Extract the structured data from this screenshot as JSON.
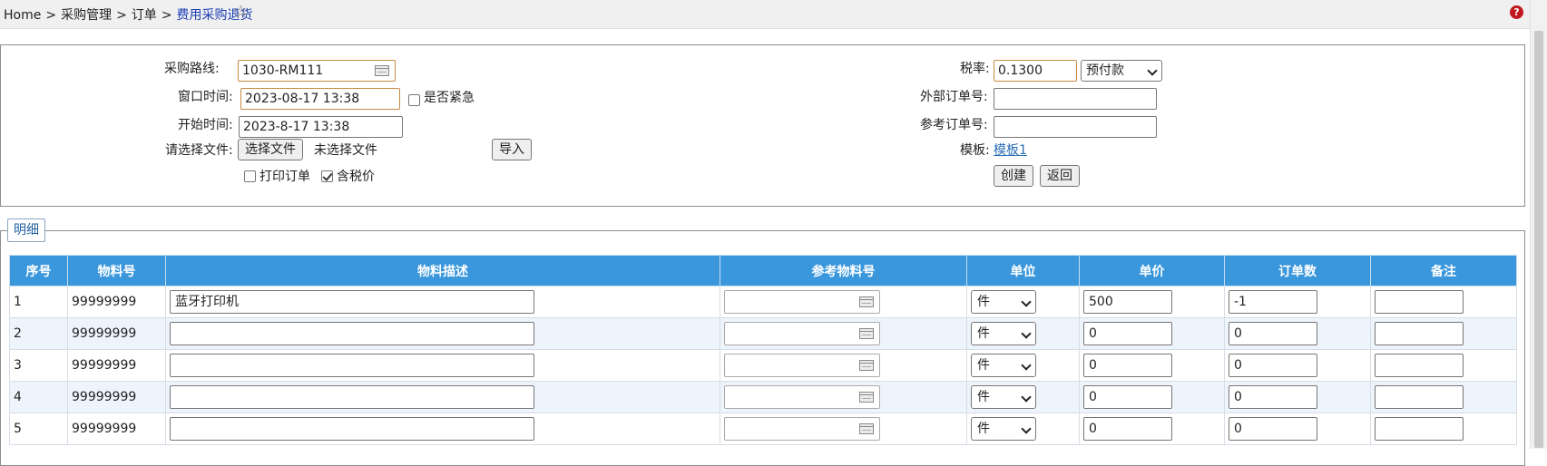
{
  "breadcrumb": {
    "home": "Home",
    "sep": ">",
    "level1": "采购管理",
    "level2": "订单",
    "current": "费用采购退货"
  },
  "header": {
    "help_glyph": "?"
  },
  "form": {
    "route_label": "采购路线:",
    "route_value": "1030-RM111",
    "window_time_label": "窗口时间:",
    "window_time_value": "2023-08-17 13:38",
    "urgent_label": "是否紧急",
    "urgent_checked": false,
    "start_time_label": "开始时间:",
    "start_time_value": "2023-8-17 13:38",
    "file_label": "请选择文件:",
    "file_button": "选择文件",
    "file_status": "未选择文件",
    "import_button": "导入",
    "print_label": "打印订单",
    "print_checked": false,
    "tax_incl_label": "含税价",
    "tax_incl_checked": true,
    "tax_rate_label": "税率:",
    "tax_rate_value": "0.1300",
    "payment_selected": "预付款",
    "external_order_label": "外部订单号:",
    "external_order_value": "",
    "ref_order_label": "参考订单号:",
    "ref_order_value": "",
    "template_label": "模板:",
    "template_link": "模板1",
    "create_button": "创建",
    "back_button": "返回"
  },
  "detail": {
    "legend": "明细",
    "columns": [
      "序号",
      "物料号",
      "物料描述",
      "参考物料号",
      "单位",
      "单价",
      "订单数",
      "备注"
    ],
    "rows": [
      {
        "no": "1",
        "material": "99999999",
        "desc": "蓝牙打印机",
        "unit": "件",
        "price": "500",
        "qty": "-1",
        "note": ""
      },
      {
        "no": "2",
        "material": "99999999",
        "desc": "",
        "unit": "件",
        "price": "0",
        "qty": "0",
        "note": ""
      },
      {
        "no": "3",
        "material": "99999999",
        "desc": "",
        "unit": "件",
        "price": "0",
        "qty": "0",
        "note": ""
      },
      {
        "no": "4",
        "material": "99999999",
        "desc": "",
        "unit": "件",
        "price": "0",
        "qty": "0",
        "note": ""
      },
      {
        "no": "5",
        "material": "99999999",
        "desc": "",
        "unit": "件",
        "price": "0",
        "qty": "0",
        "note": ""
      }
    ]
  },
  "colors": {
    "table_header": "#3a97dc",
    "alt_row": "#eef4fb",
    "link": "#2a6db5",
    "breadcrumb_current": "#1a3db5",
    "help_icon": "#c0181e",
    "focus_border": "#c88a42"
  }
}
